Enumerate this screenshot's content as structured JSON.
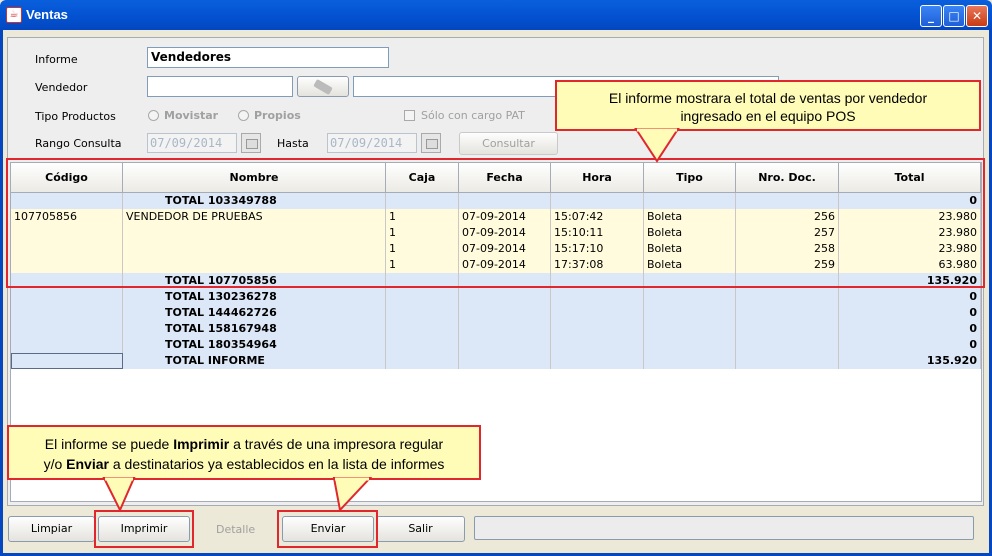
{
  "window": {
    "title": "Ventas",
    "icon": "java-icon"
  },
  "form": {
    "informe_label": "Informe",
    "informe_value": "Vendedores",
    "vendedor_label": "Vendedor",
    "tipo_label": "Tipo Productos",
    "radio_movistar": "Movistar",
    "radio_propios": "Propios",
    "solo_pat": "Sólo con cargo PAT",
    "rango_label": "Rango Consulta",
    "desde": "07/09/2014",
    "hasta_label": "Hasta",
    "hasta": "07/09/2014",
    "consultar": "Consultar"
  },
  "table": {
    "headers": [
      "Código",
      "Nombre",
      "Caja",
      "Fecha",
      "Hora",
      "Tipo",
      "Nro. Doc.",
      "Total"
    ],
    "rows": [
      {
        "kind": "tot",
        "codigo": "",
        "nombre": "TOTAL 103349788",
        "caja": "",
        "fecha": "",
        "hora": "",
        "tipo": "",
        "nro": "",
        "total": "0"
      },
      {
        "kind": "det",
        "codigo": "107705856",
        "nombre": "VENDEDOR DE PRUEBAS",
        "caja": "1",
        "fecha": "07-09-2014",
        "hora": "15:07:42",
        "tipo": "Boleta",
        "nro": "256",
        "total": "23.980"
      },
      {
        "kind": "det",
        "codigo": "",
        "nombre": "",
        "caja": "1",
        "fecha": "07-09-2014",
        "hora": "15:10:11",
        "tipo": "Boleta",
        "nro": "257",
        "total": "23.980"
      },
      {
        "kind": "det",
        "codigo": "",
        "nombre": "",
        "caja": "1",
        "fecha": "07-09-2014",
        "hora": "15:17:10",
        "tipo": "Boleta",
        "nro": "258",
        "total": "23.980"
      },
      {
        "kind": "det",
        "codigo": "",
        "nombre": "",
        "caja": "1",
        "fecha": "07-09-2014",
        "hora": "17:37:08",
        "tipo": "Boleta",
        "nro": "259",
        "total": "63.980"
      },
      {
        "kind": "tot",
        "codigo": "",
        "nombre": "TOTAL 107705856",
        "caja": "",
        "fecha": "",
        "hora": "",
        "tipo": "",
        "nro": "",
        "total": "135.920"
      },
      {
        "kind": "tot",
        "codigo": "",
        "nombre": "TOTAL 130236278",
        "caja": "",
        "fecha": "",
        "hora": "",
        "tipo": "",
        "nro": "",
        "total": "0"
      },
      {
        "kind": "tot",
        "codigo": "",
        "nombre": "TOTAL 144462726",
        "caja": "",
        "fecha": "",
        "hora": "",
        "tipo": "",
        "nro": "",
        "total": "0"
      },
      {
        "kind": "tot",
        "codigo": "",
        "nombre": "TOTAL 158167948",
        "caja": "",
        "fecha": "",
        "hora": "",
        "tipo": "",
        "nro": "",
        "total": "0"
      },
      {
        "kind": "tot",
        "codigo": "",
        "nombre": "TOTAL 180354964",
        "caja": "",
        "fecha": "",
        "hora": "",
        "tipo": "",
        "nro": "",
        "total": "0"
      },
      {
        "kind": "tot",
        "codigo": "",
        "nombre": "TOTAL INFORME",
        "caja": "",
        "fecha": "",
        "hora": "",
        "tipo": "",
        "nro": "",
        "total": "135.920"
      }
    ]
  },
  "buttons": {
    "limpiar": "Limpiar",
    "imprimir": "Imprimir",
    "detalle": "Detalle",
    "enviar": "Enviar",
    "salir": "Salir"
  },
  "callouts": {
    "top_line1": "El informe mostrara el total de ventas por vendedor",
    "top_line2": "ingresado en el equipo POS",
    "bottom_line1_pre": "El informe se puede ",
    "bottom_line1_b": "Imprimir",
    "bottom_line1_post": " a través de una impresora regular",
    "bottom_line2_pre": "y/o ",
    "bottom_line2_b": "Enviar",
    "bottom_line2_post": " a destinatarios ya establecidos en la lista de informes"
  },
  "colors": {
    "annotation_border": "#e0272e",
    "annotation_fill": "#fffcb8",
    "total_row": "#dce7f7",
    "detail_row": "#fffbdc"
  }
}
